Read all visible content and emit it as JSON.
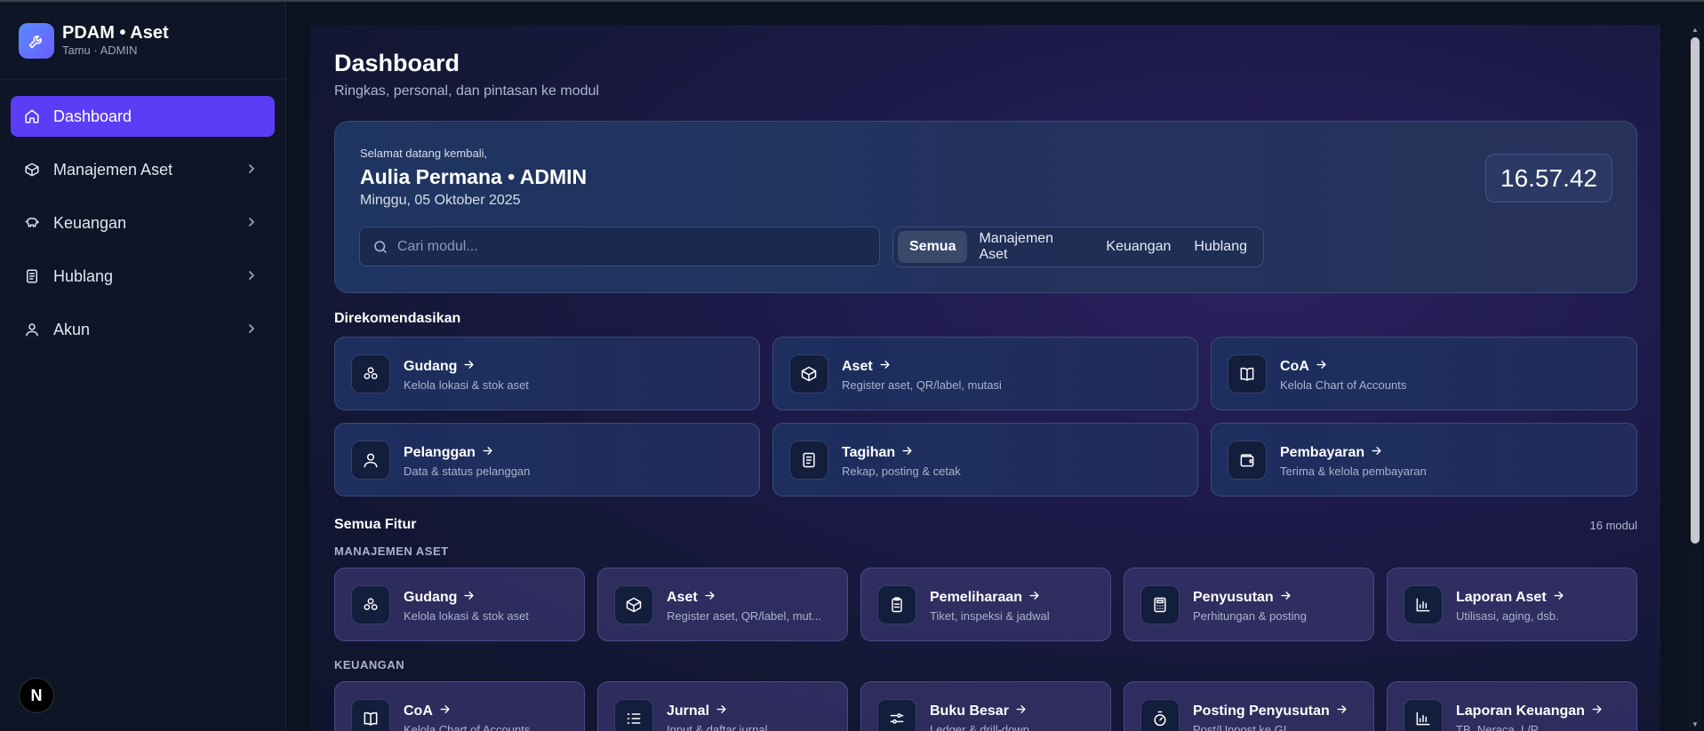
{
  "brand": {
    "title": "PDAM • Aset",
    "subtitle": "Tamu · ADMIN"
  },
  "sidebar": {
    "items": [
      {
        "label": "Dashboard",
        "icon": "home-icon",
        "active": true
      },
      {
        "label": "Manajemen Aset",
        "icon": "box-icon"
      },
      {
        "label": "Keuangan",
        "icon": "piggy-bank-icon"
      },
      {
        "label": "Hublang",
        "icon": "document-icon"
      },
      {
        "label": "Akun",
        "icon": "user-icon"
      }
    ],
    "footer_badge": "N"
  },
  "header": {
    "title": "Dashboard",
    "subtitle": "Ringkas, personal, dan pintasan ke modul"
  },
  "hero": {
    "welcome": "Selamat datang kembali,",
    "name": "Aulia Permana • ADMIN",
    "date": "Minggu, 05 Oktober 2025",
    "clock": "16.57.42",
    "search_placeholder": "Cari modul...",
    "filters": [
      "Semua",
      "Manajemen Aset",
      "Keuangan",
      "Hublang"
    ],
    "active_filter": "Semua"
  },
  "recommended": {
    "title": "Direkomendasikan",
    "cards": [
      {
        "title": "Gudang",
        "desc": "Kelola lokasi & stok aset",
        "icon": "warehouse-icon"
      },
      {
        "title": "Aset",
        "desc": "Register aset, QR/label, mutasi",
        "icon": "box-icon"
      },
      {
        "title": "CoA",
        "desc": "Kelola Chart of Accounts",
        "icon": "book-icon"
      },
      {
        "title": "Pelanggan",
        "desc": "Data & status pelanggan",
        "icon": "user-icon"
      },
      {
        "title": "Tagihan",
        "desc": "Rekap, posting & cetak",
        "icon": "document-icon"
      },
      {
        "title": "Pembayaran",
        "desc": "Terima & kelola pembayaran",
        "icon": "wallet-icon"
      }
    ]
  },
  "all_features": {
    "title": "Semua Fitur",
    "count": "16 modul",
    "groups": [
      {
        "label": "MANAJEMEN ASET",
        "cards": [
          {
            "title": "Gudang",
            "desc": "Kelola lokasi & stok aset",
            "icon": "warehouse-icon"
          },
          {
            "title": "Aset",
            "desc": "Register aset, QR/label, mut...",
            "icon": "box-icon"
          },
          {
            "title": "Pemeliharaan",
            "desc": "Tiket, inspeksi & jadwal",
            "icon": "clipboard-icon"
          },
          {
            "title": "Penyusutan",
            "desc": "Perhitungan & posting",
            "icon": "calculator-icon"
          },
          {
            "title": "Laporan Aset",
            "desc": "Utilisasi, aging, dsb.",
            "icon": "bar-chart-icon"
          }
        ]
      },
      {
        "label": "KEUANGAN",
        "cards": [
          {
            "title": "CoA",
            "desc": "Kelola Chart of Accounts",
            "icon": "book-icon"
          },
          {
            "title": "Jurnal",
            "desc": "Input & daftar jurnal",
            "icon": "list-icon"
          },
          {
            "title": "Buku Besar",
            "desc": "Ledger & drill-down",
            "icon": "sliders-icon"
          },
          {
            "title": "Posting Penyusutan",
            "desc": "Post/Unpost ke GL",
            "icon": "timer-icon"
          },
          {
            "title": "Laporan Keuangan",
            "desc": "TB, Neraca, L/R",
            "icon": "bar-chart-icon"
          }
        ]
      }
    ]
  }
}
